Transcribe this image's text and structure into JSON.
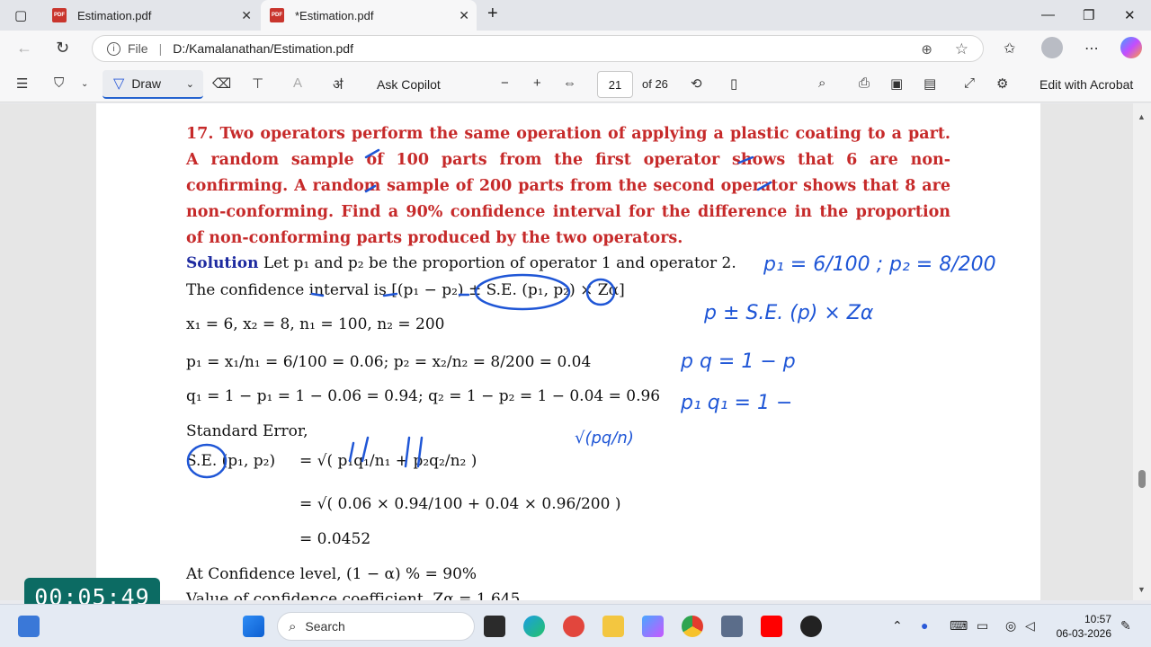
{
  "tabs": [
    {
      "title": "Estimation.pdf",
      "close": "✕"
    },
    {
      "title": "*Estimation.pdf",
      "close": "✕"
    }
  ],
  "address": {
    "file_label": "File",
    "separator": "|",
    "url": "D:/Kamalanathan/Estimation.pdf"
  },
  "toolbar": {
    "draw_label": "Draw",
    "ask_copilot": "Ask Copilot",
    "page_number": "21",
    "page_total": "of 26",
    "edit_acrobat": "Edit with Acrobat",
    "read_aloud_glyph": "ॳ"
  },
  "document": {
    "problem": "17. Two operators perform the same operation of applying a plastic coating to a part. A random sample of 100 parts from the first operator shows that 6 are non-confirming. A random sample of 200 parts from the second operator shows that 8 are non-conforming. Find a 90% confidence interval for the difference in the proportion of non-conforming parts produced by the two operators.",
    "solution_label": "Solution",
    "solution_text": " Let p₁ and p₂ be the proportion of operator 1 and operator 2.",
    "ci_line": "The confidence interval is [(p₁ − p₂) ± S.E. (p₁, p₂) × Zα]",
    "given_line": "x₁ = 6, x₂ = 8, n₁ = 100, n₂ = 200",
    "p_line": "p₁ = x₁/n₁ = 6/100 = 0.06;   p₂ = x₂/n₂ = 8/200 = 0.04",
    "q_line": "q₁ = 1 − p₁ = 1 − 0.06 = 0.94; q₂ = 1 − p₂ = 1 − 0.04 = 0.96",
    "se_label": "Standard Error,",
    "se_lhs": "S.E. (p₁, p₂)",
    "se_formula": "= √( p₁q₁/n₁ + p₂q₂/n₂ )",
    "se_numeric": "= √( 0.06 × 0.94/100 + 0.04 × 0.96/200 )",
    "se_result": "= 0.0452",
    "conf_line": "At Confidence level, (1 − α) % = 90%",
    "coef_line": "Value of confidence coefficient, Zα = 1.645"
  },
  "annotations": {
    "note1": "p₁ = 6/100 ; p₂ = 8/200",
    "note2": "p ± S.E. (p) × Zα",
    "note3": "p    q = 1 − p",
    "note4": "p₁   q₁ = 1 −",
    "note5": "√(pq/n)"
  },
  "timer": "00:05:49",
  "taskbar": {
    "search_label": "Search",
    "time": "10:57",
    "date": "06-03-2026"
  },
  "colors": {
    "problem_red": "#c62a2a",
    "solution_blue": "#1d2aa0",
    "ink_blue": "#1f56d6",
    "timer_bg": "#0c6b63"
  }
}
